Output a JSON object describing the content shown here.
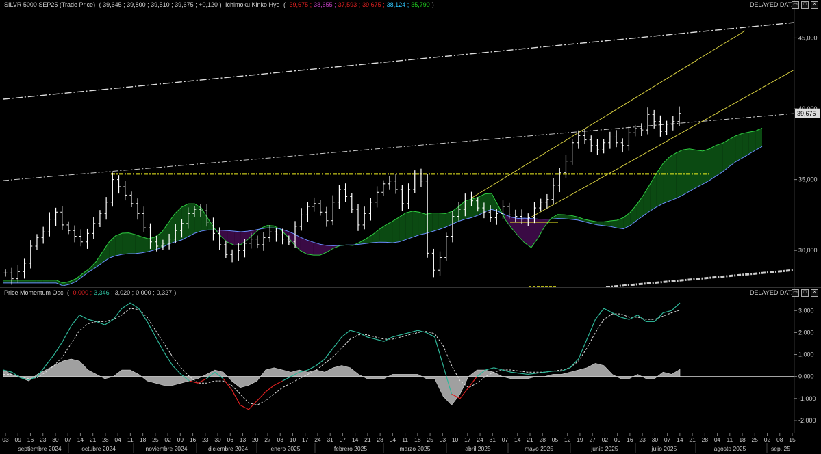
{
  "price_panel": {
    "instrument": "SILVR 5000 SEP25 (Trade Price)",
    "ohlc": "( 39,645 ; 39,800 ; 39,510 ; 39,675 ; +0,120 )",
    "indicator_name": "Ichimoku Kinko Hyo",
    "indicator_values": [
      {
        "text": "39,675",
        "color": "#e02020"
      },
      {
        "text": "38,655",
        "color": "#c040c0"
      },
      {
        "text": "37,593",
        "color": "#e02020"
      },
      {
        "text": "39,675",
        "color": "#e02020"
      },
      {
        "text": "38,124",
        "color": "#30c8ff"
      },
      {
        "text": "35,790",
        "color": "#20d020"
      }
    ],
    "delayed": "DELAYED DATA",
    "last_price_label": "39,675"
  },
  "osc_panel": {
    "name": "Price Momentum Osc",
    "values": [
      {
        "text": "0,000",
        "color": "#e02020"
      },
      {
        "text": "3,346",
        "color": "#30c0a0"
      },
      {
        "text": "3,020",
        "color": "#cccccc"
      },
      {
        "text": "0,000",
        "color": "#cccccc"
      },
      {
        "text": "0,327",
        "color": "#cccccc"
      }
    ],
    "delayed": "DELAYED DATA"
  },
  "window_buttons": [
    "▭",
    "□",
    "✕"
  ],
  "chart_data": [
    {
      "type": "candlestick",
      "title": "SILVR 5000 SEP25 (Trade Price)",
      "y_ticks": [
        "30,000",
        "35,000",
        "40,000",
        "45,000"
      ],
      "ylim": [
        27500,
        47000
      ],
      "x_range_bars": 230,
      "series": [
        {
          "name": "price",
          "closes": [
            28400,
            28000,
            28500,
            29100,
            30300,
            30900,
            31300,
            32200,
            32700,
            31800,
            31400,
            31000,
            30600,
            31200,
            31900,
            32600,
            33400,
            35000,
            34500,
            33900,
            33300,
            32600,
            31600,
            30600,
            30300,
            30500,
            30800,
            31400,
            31900,
            32600,
            32900,
            32800,
            32000,
            31200,
            30400,
            29700,
            29600,
            30000,
            30500,
            30800,
            30400,
            30900,
            31300,
            31100,
            30800,
            30600,
            31700,
            32500,
            33100,
            33300,
            32700,
            32100,
            33400,
            34300,
            33800,
            32900,
            31800,
            32600,
            33400,
            34100,
            34700,
            34900,
            34300,
            33300,
            34300,
            35400,
            34900,
            29800,
            28600,
            29500,
            31000,
            32400,
            32900,
            33700,
            33500,
            33000,
            32700,
            32300,
            32600,
            33100,
            32500,
            32400,
            32200,
            32300,
            33000,
            33400,
            33600,
            34600,
            35500,
            36300,
            37600,
            38100,
            37800,
            37400,
            37100,
            37600,
            38000,
            37600,
            37400,
            38300,
            38600,
            38500,
            39600,
            39100,
            38400,
            38900,
            39100,
            39675
          ]
        }
      ],
      "indicators": {
        "resistance_dashed": 35400,
        "support_short": 32000
      }
    },
    {
      "type": "line",
      "title": "Price Momentum Osc",
      "y_ticks": [
        "-2,000",
        "-1,000",
        "0,000",
        "1,000",
        "2,000",
        "3,000"
      ],
      "ylim": [
        -2500,
        3600
      ],
      "series": [
        {
          "name": "osc",
          "values": [
            300,
            200,
            -50,
            -150,
            0,
            500,
            1000,
            1600,
            2300,
            2800,
            2600,
            2500,
            2350,
            2600,
            3100,
            3350,
            3100,
            2500,
            1800,
            1100,
            500,
            100,
            -200,
            -300,
            -100,
            200,
            -100,
            -600,
            -1300,
            -1500,
            -1100,
            -700,
            -400,
            -200,
            0,
            200,
            300,
            500,
            800,
            1300,
            1800,
            2100,
            2000,
            1800,
            1700,
            1600,
            1800,
            1900,
            2000,
            2100,
            2000,
            1800,
            500,
            -800,
            -1000,
            -500,
            0,
            300,
            400,
            300,
            200,
            150,
            100,
            150,
            200,
            250,
            250,
            400,
            800,
            1700,
            2600,
            3100,
            2900,
            2700,
            2600,
            2800,
            2500,
            2500,
            2900,
            3000,
            3350
          ]
        },
        {
          "name": "signal",
          "values": [
            100,
            100,
            0,
            -100,
            -50,
            200,
            500,
            900,
            1500,
            2100,
            2400,
            2500,
            2500,
            2600,
            2800,
            3100,
            3050,
            2700,
            2100,
            1500,
            900,
            400,
            0,
            -300,
            -300,
            -200,
            -200,
            -400,
            -800,
            -1200,
            -1300,
            -1100,
            -800,
            -500,
            -300,
            -100,
            100,
            300,
            600,
            900,
            1300,
            1700,
            1900,
            1900,
            1800,
            1700,
            1700,
            1800,
            1900,
            2000,
            2050,
            1950,
            1400,
            500,
            -200,
            -500,
            -300,
            0,
            200,
            300,
            300,
            250,
            200,
            200,
            200,
            250,
            300,
            400,
            700,
            1300,
            2000,
            2600,
            2850,
            2850,
            2700,
            2700,
            2600,
            2600,
            2750,
            2900,
            3020
          ]
        },
        {
          "name": "histogram",
          "values": [
            300,
            100,
            -50,
            -200,
            100,
            300,
            500,
            700,
            800,
            700,
            300,
            100,
            -100,
            0,
            300,
            300,
            100,
            -200,
            -300,
            -400,
            -400,
            -300,
            -200,
            -100,
            100,
            300,
            200,
            -200,
            -500,
            -400,
            -200,
            300,
            400,
            300,
            200,
            300,
            200,
            300,
            200,
            400,
            500,
            400,
            100,
            -100,
            -100,
            -100,
            100,
            100,
            100,
            100,
            -100,
            -100,
            -900,
            -1300,
            -800,
            0,
            300,
            300,
            200,
            0,
            -100,
            -100,
            -100,
            0,
            0,
            100,
            100,
            200,
            300,
            400,
            600,
            500,
            100,
            -100,
            -100,
            100,
            -100,
            -100,
            200,
            100,
            327
          ]
        }
      ]
    }
  ],
  "time_axis": {
    "days": [
      "03",
      "09",
      "16",
      "23",
      "30",
      "07",
      "14",
      "21",
      "28",
      "04",
      "11",
      "18",
      "25",
      "02",
      "09",
      "16",
      "23",
      "30",
      "06",
      "13",
      "20",
      "27",
      "03",
      "10",
      "17",
      "24",
      "31",
      "07",
      "14",
      "21",
      "28",
      "04",
      "11",
      "18",
      "25",
      "03",
      "10",
      "17",
      "24",
      "31",
      "07",
      "14",
      "21",
      "28",
      "05",
      "12",
      "19",
      "27",
      "02",
      "09",
      "16",
      "23",
      "30",
      "07",
      "14",
      "21",
      "28",
      "04",
      "11",
      "18",
      "25",
      "02",
      "08",
      "15"
    ],
    "months": [
      "septiembre 2024",
      "octubre 2024",
      "noviembre 2024",
      "diciembre 2024",
      "enero 2025",
      "febrero 2025",
      "marzo 2025",
      "abril 2025",
      "mayo 2025",
      "junio 2025",
      "julio 2025",
      "agosto 2025",
      "sep. 25"
    ]
  }
}
